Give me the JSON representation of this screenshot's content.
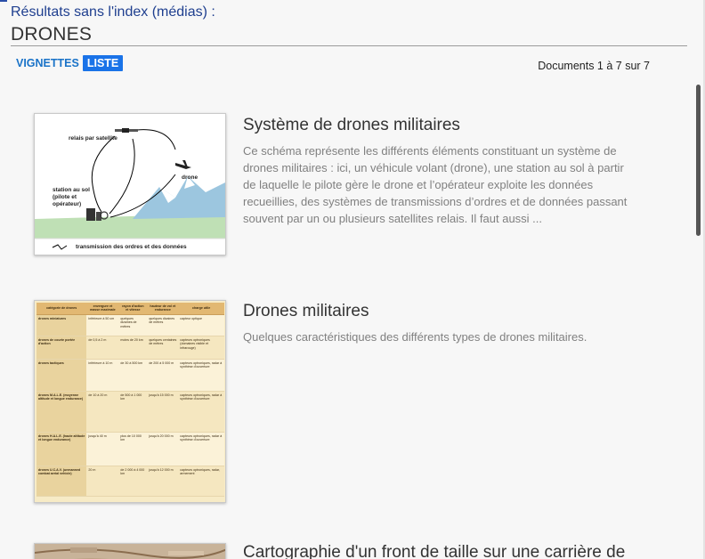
{
  "header": {
    "results_label": "Résultats sans l'index (médias) :",
    "query": "DRONES"
  },
  "view_toggle": {
    "grid_label": "VIGNETTES",
    "list_label": "LISTE",
    "active": "LISTE"
  },
  "doc_count": "Documents 1 à 7 sur 7",
  "results": [
    {
      "title": "Système de drones militaires",
      "description": "Ce schéma représente les différents éléments constituant un système de drones militaires : ici, un véhicule volant (drone), une station au sol à partir de laquelle le pilote gère le drone et l’opérateur exploite les données recueillies, des systèmes de transmissions d’ordres et de données passant souvent par un ou plusieurs satellites relais. Il faut aussi ...",
      "thumb_labels": {
        "satellite": "relais par satellite",
        "drone": "drone",
        "station": "station au sol (pilote et opérateur)",
        "legend": "transmission des ordres et des données"
      }
    },
    {
      "title": "Drones militaires",
      "description": "Quelques caractéristiques des différents types de drones militaires.",
      "thumb_table": {
        "headers": [
          "catégorie de drones",
          "envergure et masse maximale",
          "rayon d'action et vitesse",
          "hauteur de vol et endurance",
          "charge utile"
        ],
        "rows": [
          [
            "drones miniatures",
            "inférieure à 50 cm",
            "quelques dizaines de mètres",
            "quelques dizaines de mètres",
            "capteur optique"
          ],
          [
            "drones de courte portée d'action",
            "de 0,5 à 2 m",
            "moins de 20 km",
            "quelques centaines de mètres",
            "capteurs optroniques (domaines visible et infrarouge)"
          ],
          [
            "drones tactiques",
            "inférieure à 10 m",
            "de 30 à 500 km",
            "de 200 à 5 000 m",
            "capteurs optroniques, radar à synthèse d'ouverture"
          ],
          [
            "drones M.A.L.E. (moyenne altitude et longue endurance)",
            "de 10 à 20 m",
            "de 500 à 1 000 km",
            "jusqu'à 15 000 m",
            "capteurs optroniques, radar à synthèse d'ouverture"
          ],
          [
            "drones H.A.L.E. (haute altitude et longue endurance)",
            "jusqu'à 40 m",
            "plus de 10 000 km",
            "jusqu'à 20 000 m",
            "capteurs optroniques, radar à synthèse d'ouverture"
          ],
          [
            "drones U.C.A.V. (unmanned combat aerial vehicle)",
            "20 m",
            "de 2 000 à 4 000 km",
            "jusqu'à 12 000 m",
            "capteurs optroniques, radar, armement"
          ]
        ]
      }
    },
    {
      "title": "Cartographie d'un front de taille sur une carrière de"
    }
  ],
  "colors": {
    "accent": "#1a73e8",
    "header_text": "#1f3f8f",
    "table_header": "#e2b872"
  }
}
